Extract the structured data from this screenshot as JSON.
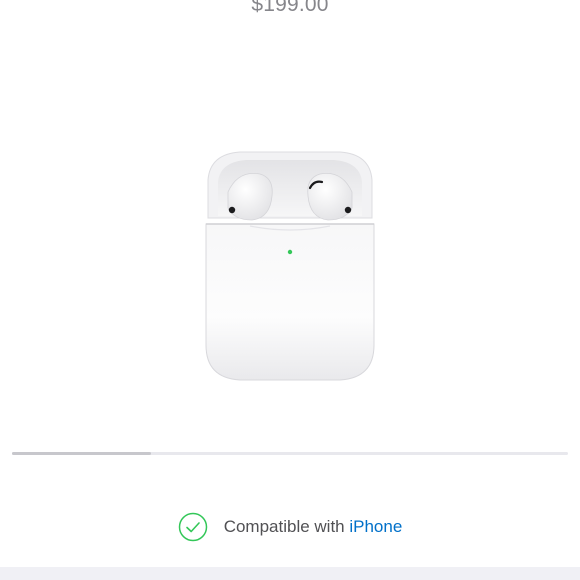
{
  "product": {
    "price": "$199.00"
  },
  "gallery": {
    "position_fraction": 0.25
  },
  "compatibility": {
    "prefix": "Compatible with ",
    "device": "iPhone",
    "check_color": "#34c759",
    "link_color": "#0070c9"
  },
  "icons": {
    "check": "check-circle-icon"
  }
}
